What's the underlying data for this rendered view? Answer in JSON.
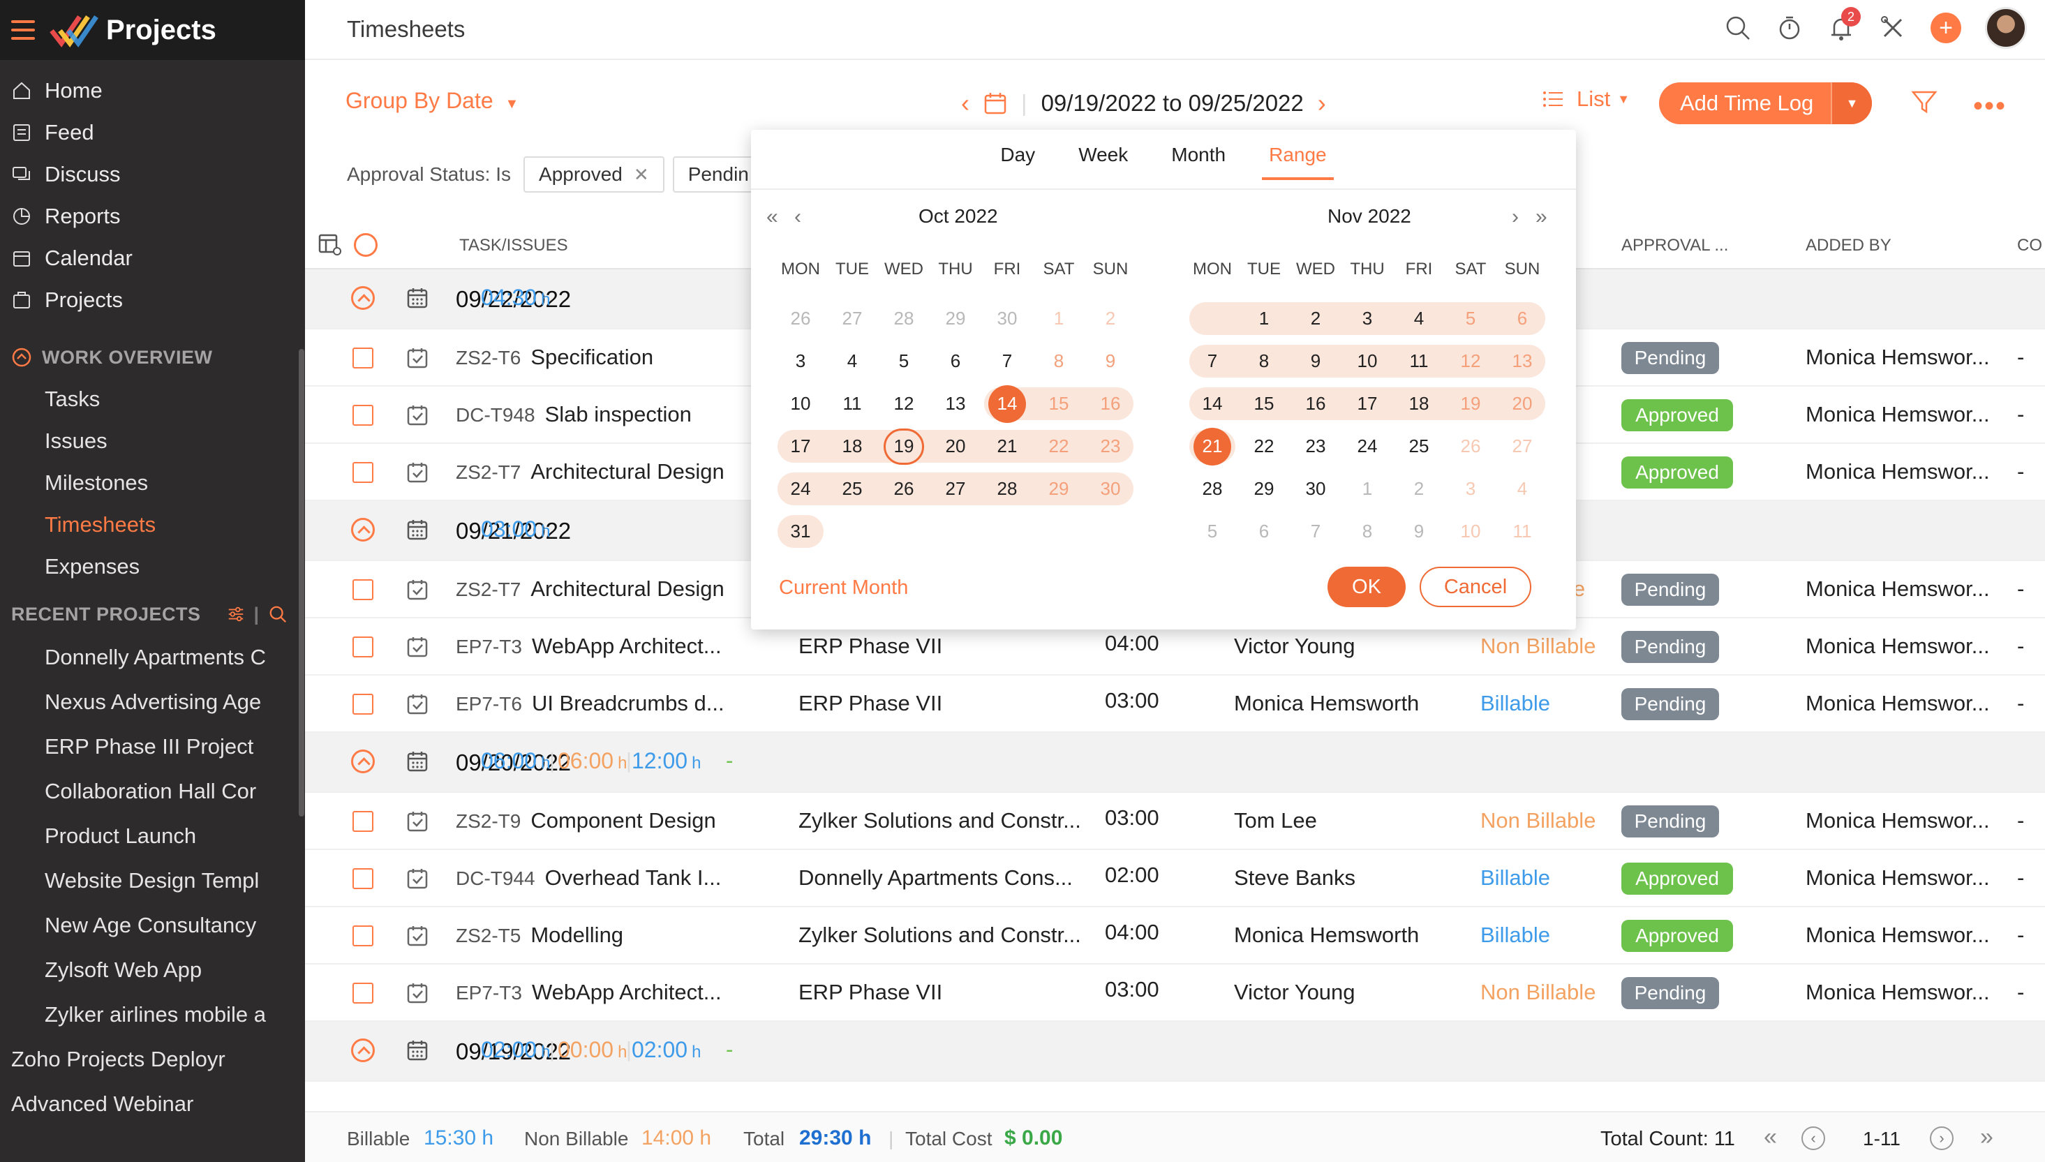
{
  "app": {
    "title": "Projects",
    "page_title": "Timesheets"
  },
  "sidebar": {
    "main": [
      {
        "label": "Home",
        "icon": "home-icon"
      },
      {
        "label": "Feed",
        "icon": "feed-icon"
      },
      {
        "label": "Discuss",
        "icon": "discuss-icon"
      },
      {
        "label": "Reports",
        "icon": "reports-icon"
      },
      {
        "label": "Calendar",
        "icon": "calendar-icon"
      },
      {
        "label": "Projects",
        "icon": "projects-icon"
      }
    ],
    "work_overview_title": "WORK OVERVIEW",
    "work_overview": [
      "Tasks",
      "Issues",
      "Milestones",
      "Timesheets",
      "Expenses"
    ],
    "active_item": "Timesheets",
    "recent_title": "RECENT PROJECTS",
    "recent_projects": [
      "Donnelly Apartments C",
      "Nexus Advertising Age",
      "ERP Phase III Project",
      "Collaboration Hall Cor",
      "Product Launch",
      "Website Design Templ",
      "New Age Consultancy",
      "Zylsoft Web App",
      "Zylker airlines mobile a",
      "Zoho Projects Deployr",
      "Advanced Webinar"
    ]
  },
  "topbar": {
    "notification_count": "2",
    "plus": "+"
  },
  "toolbar": {
    "group_by": "Group By Date",
    "date_range": "09/19/2022 to 09/25/2022",
    "view": "List",
    "add_time_log": "Add Time Log",
    "more": "•••"
  },
  "filters": {
    "label": "Approval Status: Is",
    "chips": [
      "Approved",
      "Pendin"
    ]
  },
  "table": {
    "headers": {
      "task": "TASK/ISSUES",
      "approval": "APPROVAL ...",
      "added_by": "ADDED BY",
      "co": "CO"
    },
    "groups": [
      {
        "date": "09/22/2022",
        "hours": [
          "04:30"
        ],
        "rows": [
          {
            "id": "ZS2-T6",
            "name": "Specification",
            "project": "",
            "time": "",
            "user": "",
            "billing": "",
            "status": "Pending",
            "added_by": "Monica Hemswor...",
            "dash": "-"
          },
          {
            "id": "DC-T948",
            "name": "Slab inspection",
            "project": "",
            "time": "",
            "user": "",
            "billing": "",
            "status": "Approved",
            "added_by": "Monica Hemswor...",
            "dash": "-"
          },
          {
            "id": "ZS2-T7",
            "name": "Architectural Design",
            "project": "",
            "time": "",
            "user": "",
            "billing": "",
            "status": "Approved",
            "added_by": "Monica Hemswor...",
            "dash": "-"
          }
        ]
      },
      {
        "date": "09/21/2022",
        "hours": [
          "03:00"
        ],
        "rows": [
          {
            "id": "ZS2-T7",
            "name": "Architectural Design",
            "project": "",
            "time": "",
            "user": "",
            "billing": "le",
            "billing_class": "nonbillable",
            "status": "Pending",
            "added_by": "Monica Hemswor...",
            "dash": "-"
          },
          {
            "id": "EP7-T3",
            "name": "WebApp Architect...",
            "project": "ERP Phase VII",
            "time": "04:00",
            "user": "Victor Young",
            "billing": "Non Billable",
            "billing_class": "nonbillable",
            "status": "Pending",
            "added_by": "Monica Hemswor...",
            "dash": "-"
          },
          {
            "id": "EP7-T6",
            "name": "UI Breadcrumbs d...",
            "project": "ERP Phase VII",
            "time": "03:00",
            "user": "Monica Hemsworth",
            "billing": "Billable",
            "billing_class": "billable",
            "status": "Pending",
            "added_by": "Monica Hemswor...",
            "dash": "-"
          }
        ]
      },
      {
        "date": "09/20/2022",
        "hours": [
          "06:00",
          "06:00",
          "12:00"
        ],
        "dash": "-",
        "rows": [
          {
            "id": "ZS2-T9",
            "name": "Component Design",
            "project": "Zylker Solutions and Constr...",
            "time": "03:00",
            "user": "Tom Lee",
            "billing": "Non Billable",
            "billing_class": "nonbillable",
            "status": "Pending",
            "added_by": "Monica Hemswor...",
            "dash": "-"
          },
          {
            "id": "DC-T944",
            "name": "Overhead Tank I...",
            "project": "Donnelly Apartments Cons...",
            "time": "02:00",
            "user": "Steve Banks",
            "billing": "Billable",
            "billing_class": "billable",
            "status": "Approved",
            "added_by": "Monica Hemswor...",
            "dash": "-"
          },
          {
            "id": "ZS2-T5",
            "name": "Modelling",
            "project": "Zylker Solutions and Constr...",
            "time": "04:00",
            "user": "Monica Hemsworth",
            "billing": "Billable",
            "billing_class": "billable",
            "status": "Approved",
            "added_by": "Monica Hemswor...",
            "dash": "-"
          },
          {
            "id": "EP7-T3",
            "name": "WebApp Architect...",
            "project": "ERP Phase VII",
            "time": "03:00",
            "user": "Victor Young",
            "billing": "Non Billable",
            "billing_class": "nonbillable",
            "status": "Pending",
            "added_by": "Monica Hemswor...",
            "dash": "-"
          }
        ]
      },
      {
        "date": "09/19/2022",
        "hours": [
          "02:00",
          "00:00",
          "02:00"
        ],
        "dash": "-",
        "rows": []
      }
    ],
    "hour_unit": "h"
  },
  "footer": {
    "billable_label": "Billable",
    "billable": "15:30 h",
    "nonbillable_label": "Non Billable",
    "nonbillable": "14:00 h",
    "total_label": "Total",
    "total": "29:30 h",
    "cost_label": "Total Cost",
    "cost": "$ 0.00",
    "count": "Total Count: 11",
    "range": "1-11"
  },
  "picker": {
    "tabs": [
      "Day",
      "Week",
      "Month",
      "Range"
    ],
    "active_tab": "Range",
    "weekdays": [
      "MON",
      "TUE",
      "WED",
      "THU",
      "FRI",
      "SAT",
      "SUN"
    ],
    "left_month": "Oct 2022",
    "right_month": "Nov 2022",
    "left_weeks": [
      [
        "26",
        "27",
        "28",
        "29",
        "30",
        "1",
        "2"
      ],
      [
        "3",
        "4",
        "5",
        "6",
        "7",
        "8",
        "9"
      ],
      [
        "10",
        "11",
        "12",
        "13",
        "14",
        "15",
        "16"
      ],
      [
        "17",
        "18",
        "19",
        "20",
        "21",
        "22",
        "23"
      ],
      [
        "24",
        "25",
        "26",
        "27",
        "28",
        "29",
        "30"
      ],
      [
        "31",
        "",
        "",
        "",
        "",
        "",
        ""
      ]
    ],
    "right_weeks": [
      [
        "",
        "1",
        "2",
        "3",
        "4",
        "5",
        "6"
      ],
      [
        "7",
        "8",
        "9",
        "10",
        "11",
        "12",
        "13"
      ],
      [
        "14",
        "15",
        "16",
        "17",
        "18",
        "19",
        "20"
      ],
      [
        "21",
        "22",
        "23",
        "24",
        "25",
        "26",
        "27"
      ],
      [
        "28",
        "29",
        "30",
        "1",
        "2",
        "3",
        "4"
      ],
      [
        "5",
        "6",
        "7",
        "8",
        "9",
        "10",
        "11"
      ]
    ],
    "range_start": "Oct 14",
    "range_end": "Nov 21",
    "today": "Oct 19",
    "current_month": "Current Month",
    "ok": "OK",
    "cancel": "Cancel"
  },
  "colors": {
    "accent": "#ff7a45",
    "sidebar": "#2d2b2b",
    "billable": "#3d9be9",
    "non_billable": "#f4a261",
    "approved": "#6cc24a",
    "pending": "#7d8893"
  }
}
